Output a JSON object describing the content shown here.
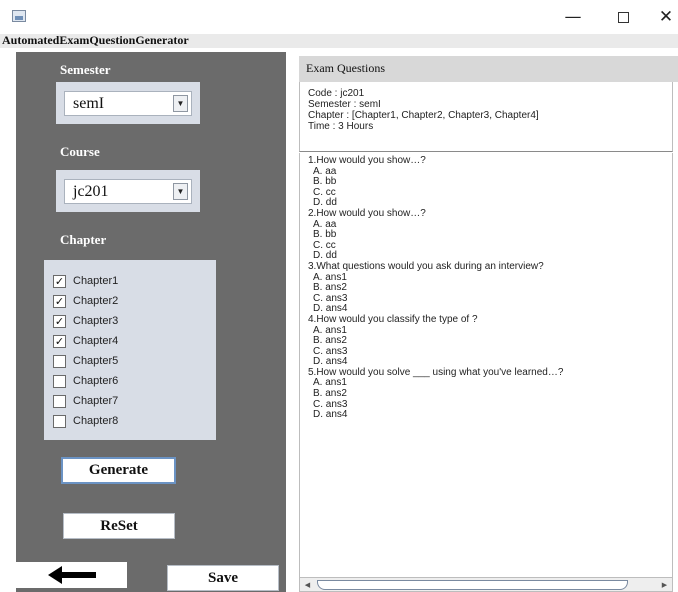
{
  "window": {
    "app_title": "AutomatedExamQuestionGenerator",
    "minimize_glyph": "—",
    "close_glyph": "✕",
    "icon": "java-app-icon"
  },
  "left": {
    "semester_label": "Semester",
    "semester_value": "semI",
    "course_label": "Course",
    "course_value": "jc201",
    "chapter_label": "Chapter",
    "chapters": [
      {
        "label": "Chapter1",
        "checked": true
      },
      {
        "label": "Chapter2",
        "checked": true
      },
      {
        "label": "Chapter3",
        "checked": true
      },
      {
        "label": "Chapter4",
        "checked": true
      },
      {
        "label": "Chapter5",
        "checked": false
      },
      {
        "label": "Chapter6",
        "checked": false
      },
      {
        "label": "Chapter7",
        "checked": false
      },
      {
        "label": "Chapter8",
        "checked": false
      }
    ],
    "generate_label": "Generate",
    "reset_label": "ReSet",
    "save_label": "Save"
  },
  "right": {
    "header": "Exam Questions",
    "info": [
      "Code : jc201",
      "Semester : semI",
      "Chapter : [Chapter1, Chapter2, Chapter3, Chapter4]",
      "Time : 3 Hours"
    ],
    "questions": [
      {
        "q": "1.How would you show…?",
        "options": [
          "A. aa",
          "B. bb",
          "C. cc",
          "D. dd"
        ]
      },
      {
        "q": "2.How would you show…?",
        "options": [
          "A. aa",
          "B. bb",
          "C. cc",
          "D. dd"
        ]
      },
      {
        "q": "3.What questions would you ask during an interview?",
        "options": [
          "A. ans1",
          "B. ans2",
          "C. ans3",
          "D. ans4"
        ]
      },
      {
        "q": "4.How would you classify the type of ?",
        "options": [
          "A. ans1",
          "B. ans2",
          "C. ans3",
          "D. ans4"
        ]
      },
      {
        "q": "5.How would you solve ___ using what you've learned…?",
        "options": [
          "A. ans1",
          "B. ans2",
          "C. ans3",
          "D. ans4"
        ]
      }
    ]
  },
  "colors": {
    "panel_bg": "#6b6b6b",
    "group_bg": "#d8dde6",
    "focus_border": "#6b93c4"
  }
}
